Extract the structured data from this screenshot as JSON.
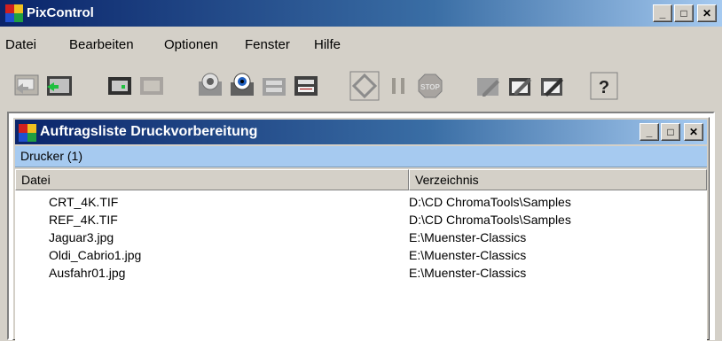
{
  "window": {
    "title": "PixControl"
  },
  "window_buttons": {
    "minimize": "_",
    "maximize": "□",
    "close": "✕"
  },
  "menu": [
    "Datei",
    "Bearbeiten",
    "Optionen",
    "Fenster",
    "Hilfe"
  ],
  "toolbar": {
    "help_glyph": "?",
    "stop_text": "STOP"
  },
  "child_window": {
    "title": "Auftragsliste Druckvorbereitung",
    "group": "Drucker (1)",
    "columns": [
      "Datei",
      "Verzeichnis"
    ],
    "rows": [
      {
        "file": "CRT_4K.TIF",
        "dir": "D:\\CD ChromaTools\\Samples"
      },
      {
        "file": "REF_4K.TIF",
        "dir": "D:\\CD ChromaTools\\Samples"
      },
      {
        "file": "Jaguar3.jpg",
        "dir": "E:\\Muenster-Classics"
      },
      {
        "file": "Oldi_Cabrio1.jpg",
        "dir": "E:\\Muenster-Classics"
      },
      {
        "file": "Ausfahr01.jpg",
        "dir": "E:\\Muenster-Classics"
      }
    ]
  }
}
